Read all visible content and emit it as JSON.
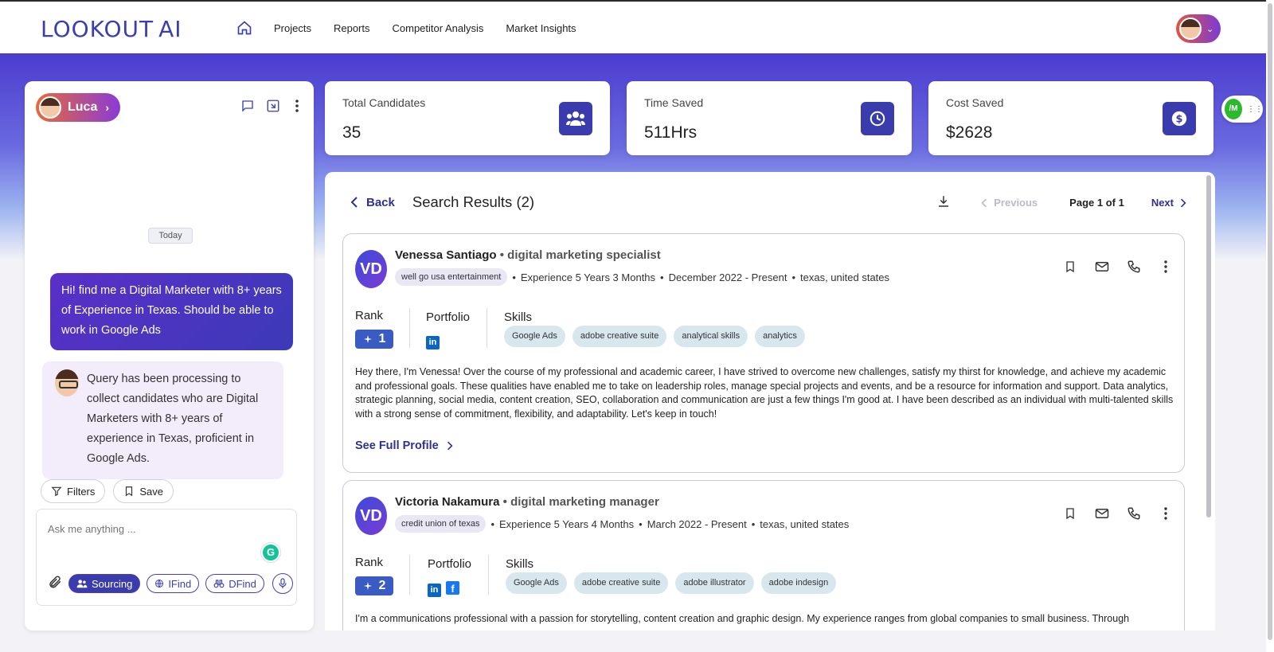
{
  "app": {
    "logo": "LOOKOUT AI",
    "logo_main": "LOOKOUT",
    "logo_ai": "AI",
    "nav": [
      "Projects",
      "Reports",
      "Competitor Analysis",
      "Market Insights"
    ]
  },
  "chat": {
    "agent_name": "Luca",
    "date_label": "Today",
    "user_message": "Hi! find me a Digital Marketer with 8+ years of Experience in Texas. Should be able to work in Google Ads",
    "bot_message": "Query has been processing to collect candidates who are Digital Marketers with 8+ years of experience in Texas, proficient in Google Ads.",
    "filters_label": "Filters",
    "save_label": "Save",
    "input_placeholder": "Ask me anything ...",
    "modes": [
      "Sourcing",
      "IFind",
      "DFind"
    ]
  },
  "stats": [
    {
      "label": "Total Candidates",
      "value": "35",
      "icon": "users-icon"
    },
    {
      "label": "Time Saved",
      "value": "511Hrs",
      "icon": "clock-icon"
    },
    {
      "label": "Cost Saved",
      "value": "$2628",
      "icon": "dollar-icon"
    }
  ],
  "results": {
    "back_label": "Back",
    "title": "Search Results (2)",
    "previous_label": "Previous",
    "page_label": "Page 1 of 1",
    "next_label": "Next",
    "rank_label": "Rank",
    "portfolio_label": "Portfolio",
    "skills_label": "Skills",
    "see_full_label": "See Full Profile",
    "candidates": [
      {
        "initials": "VD",
        "name": "Venessa Santiago",
        "role": "digital marketing specialist",
        "company": "well go usa entertainment",
        "experience": "Experience 5 Years 3 Months",
        "dates": "December 2022 - Present",
        "location": "texas, united states",
        "rank": "1",
        "skills": [
          "Google Ads",
          "adobe creative suite",
          "analytical skills",
          "analytics"
        ],
        "bio": "Hey there, I'm Venessa! Over the course of my professional and academic career, I have strived to overcome new challenges, satisfy my thirst for knowledge, and achieve my academic and professional goals. These qualities have enabled me to take on leadership roles, manage special projects and events, and be a resource for information and support. Data analytics, strategic planning, social media, content creation, SEO, collaboration and communication are just a few things I'm good at. I have been described as an individual with multi-talented skills with a strong sense of commitment, flexibility, and adaptability. Let's keep in touch!"
      },
      {
        "initials": "VD",
        "name": "Victoria Nakamura",
        "role": "digital marketing manager",
        "company": "credit union of texas",
        "experience": "Experience 5 Years 4 Months",
        "dates": "March 2022 - Present",
        "location": "texas, united states",
        "rank": "2",
        "skills": [
          "Google Ads",
          "adobe creative suite",
          "adobe illustrator",
          "adobe indesign"
        ],
        "bio": "I'm a communications professional with a passion for storytelling, content creation and graphic design. My experience ranges from global companies to small business. Through"
      }
    ]
  },
  "floating_badge": "/M",
  "colors": {
    "accent": "#3a3cae",
    "link": "#2e3192",
    "band_top": "#4b3ccf"
  }
}
